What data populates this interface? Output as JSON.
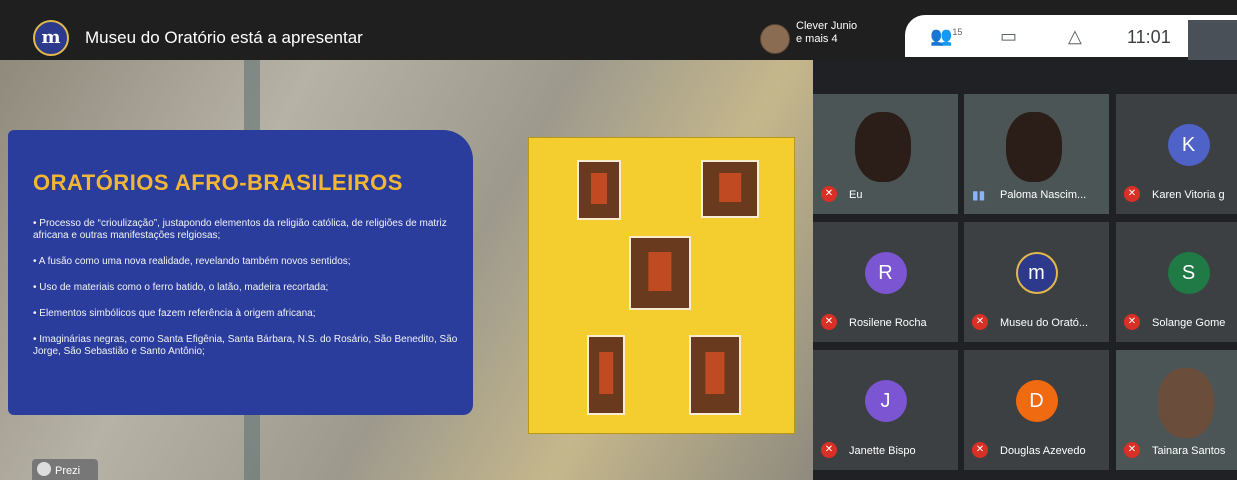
{
  "topbar": {
    "presenter_title": "Museu do Oratório está a apresentar",
    "participants_label": "Clever Junio",
    "participants_more": "e mais 4",
    "people_count": "15",
    "time": "11:01"
  },
  "slide": {
    "title": "ORATÓRIOS AFRO-BRASILEIROS",
    "bullets": [
      "• Processo de “crioulização”, justapondo elementos da religião católica, de religiões de matriz africana e outras manifestações relgiosas;",
      "• A fusão como uma nova realidade, revelando também novos sentidos;",
      "• Uso de materiais como o ferro batido, o latão, madeira recortada;",
      "• Elementos simbólicos que fazem referência à origem africana;",
      "• Imaginárias negras, como Santa Efigênia, Santa Bárbara, N.S. do Rosário, São Benedito, São Jorge, São Sebastião e Santo Antônio;"
    ],
    "watermark": "Prezi"
  },
  "participants": [
    {
      "name": "Eu",
      "initial": "",
      "color": ""
    },
    {
      "name": "Paloma Nascim...",
      "initial": "",
      "color": ""
    },
    {
      "name": "Karen Vitoria g",
      "initial": "K",
      "color": "#4f62c7"
    },
    {
      "name": "Rosilene Rocha",
      "initial": "R",
      "color": "#7b55d2"
    },
    {
      "name": "Museu do Orató...",
      "initial": "m",
      "color": "#2d3a8c"
    },
    {
      "name": "Solange Gome",
      "initial": "S",
      "color": "#1f7a46"
    },
    {
      "name": "Janette Bispo",
      "initial": "J",
      "color": "#7b55d2"
    },
    {
      "name": "Douglas Azevedo",
      "initial": "D",
      "color": "#f06a12"
    },
    {
      "name": "Tainara Santos",
      "initial": "",
      "color": ""
    }
  ]
}
